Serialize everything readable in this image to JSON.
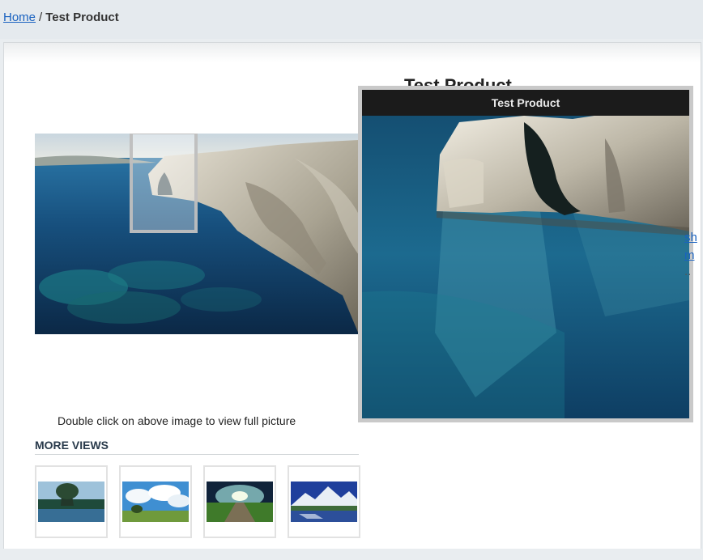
{
  "breadcrumb": {
    "home_label": "Home",
    "separator": "/",
    "current": "Test Product"
  },
  "product": {
    "title": "Test Product"
  },
  "zoom": {
    "title": "Test Product"
  },
  "hint": "Double click on above image to view full picture",
  "more_views": {
    "heading": "MORE VIEWS",
    "thumbnails": [
      {
        "icon": "forest-lake-thumbnail"
      },
      {
        "icon": "cloudy-field-thumbnail"
      },
      {
        "icon": "green-road-thumbnail"
      },
      {
        "icon": "mountain-lake-thumbnail"
      }
    ]
  },
  "side_links": {
    "link1": "sh",
    "link2": "m",
    "more": ".."
  },
  "colors": {
    "link": "#1a62c0",
    "zoom_header": "#1b1b1b"
  }
}
